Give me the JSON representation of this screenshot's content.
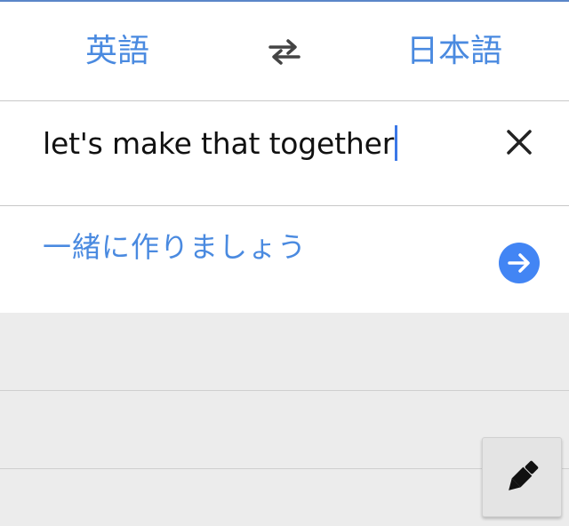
{
  "languages": {
    "source": "英語",
    "target": "日本語",
    "swap_icon": "swap-arrows-icon"
  },
  "input": {
    "text": "let's make that together",
    "clear_icon": "close-icon"
  },
  "result": {
    "text": "一緒に作りましょう",
    "go_icon": "arrow-right-circle-icon"
  },
  "toolbar": {
    "handwriting_icon": "pen-icon"
  },
  "colors": {
    "accent": "#4a8ae0",
    "go_button": "#4285f4",
    "caret": "#3b78e7",
    "history_background": "#ececec"
  }
}
